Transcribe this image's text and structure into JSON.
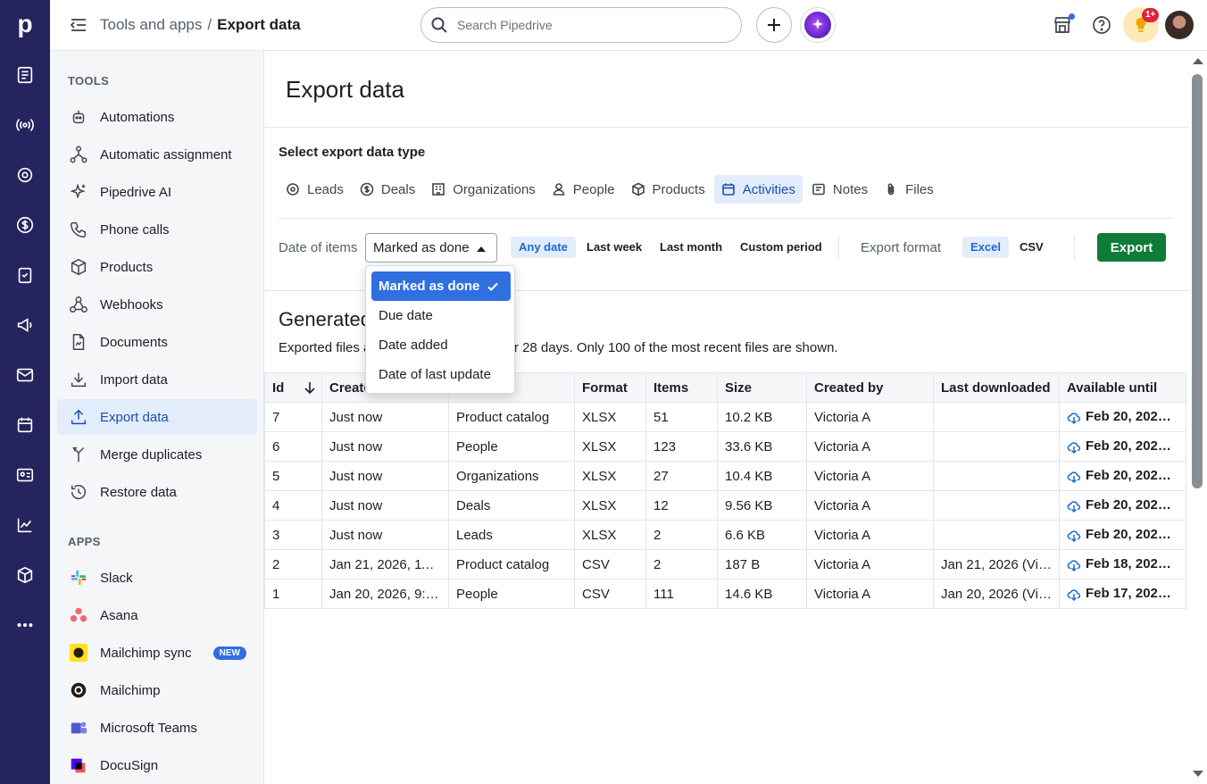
{
  "app": {
    "name": "Pipedrive"
  },
  "header": {
    "breadcrumb_parent": "Tools and apps",
    "breadcrumb_sep": "/",
    "breadcrumb_current": "Export data",
    "search_placeholder": "Search Pipedrive",
    "notification_badge": "1+"
  },
  "rail": {
    "icons": [
      "leads-inbox-icon",
      "broadcast-icon",
      "target-icon",
      "dollar-icon",
      "tasks-icon",
      "megaphone-icon",
      "mail-icon",
      "calendar-icon",
      "contacts-icon",
      "chart-icon",
      "products-box-icon",
      "more-icon"
    ]
  },
  "sidebar": {
    "tools_heading": "TOOLS",
    "tools": [
      {
        "label": "Automations",
        "icon": "robot-icon"
      },
      {
        "label": "Automatic assignment",
        "icon": "assignment-icon"
      },
      {
        "label": "Pipedrive AI",
        "icon": "sparkle-icon"
      },
      {
        "label": "Phone calls",
        "icon": "phone-icon"
      },
      {
        "label": "Products",
        "icon": "box-icon"
      },
      {
        "label": "Webhooks",
        "icon": "webhook-icon"
      },
      {
        "label": "Documents",
        "icon": "document-icon"
      },
      {
        "label": "Import data",
        "icon": "import-icon"
      },
      {
        "label": "Export data",
        "icon": "export-icon"
      },
      {
        "label": "Merge duplicates",
        "icon": "merge-icon"
      },
      {
        "label": "Restore data",
        "icon": "restore-icon"
      }
    ],
    "apps_heading": "APPS",
    "apps": [
      {
        "label": "Slack",
        "icon": "slack-icon"
      },
      {
        "label": "Asana",
        "icon": "asana-icon"
      },
      {
        "label": "Mailchimp sync",
        "icon": "mailchimp-icon",
        "badge": "NEW"
      },
      {
        "label": "Mailchimp",
        "icon": "mailchimp-icon"
      },
      {
        "label": "Microsoft Teams",
        "icon": "teams-icon"
      },
      {
        "label": "DocuSign",
        "icon": "docusign-icon"
      }
    ]
  },
  "main": {
    "title": "Export data",
    "select_type_label": "Select export data type",
    "tabs": [
      {
        "label": "Leads",
        "icon": "target-icon"
      },
      {
        "label": "Deals",
        "icon": "dollar-icon"
      },
      {
        "label": "Organizations",
        "icon": "building-icon"
      },
      {
        "label": "People",
        "icon": "person-icon"
      },
      {
        "label": "Products",
        "icon": "box-icon"
      },
      {
        "label": "Activities",
        "icon": "calendar-icon"
      },
      {
        "label": "Notes",
        "icon": "note-icon"
      },
      {
        "label": "Files",
        "icon": "paperclip-icon"
      }
    ],
    "active_tab": "Activities",
    "date_of_items_label": "Date of items",
    "date_of_items_value": "Marked as done",
    "date_filters": [
      "Any date",
      "Last week",
      "Last month",
      "Custom period"
    ],
    "active_date_filter": "Any date",
    "export_format_label": "Export format",
    "formats": [
      "Excel",
      "CSV"
    ],
    "active_format": "Excel",
    "export_button": "Export",
    "generated_title": "Generated",
    "generated_sub_before": "Exported files a",
    "generated_sub_after": "for 28 days. Only 100 of the most recent files are shown."
  },
  "dropdown": {
    "options": [
      "Marked as done",
      "Due date",
      "Date added",
      "Date of last update"
    ],
    "selected": "Marked as done"
  },
  "table": {
    "headers": [
      "Id",
      "Create",
      "",
      "Format",
      "Items",
      "Size",
      "Created by",
      "Last downloaded",
      "Available until"
    ],
    "rows": [
      [
        "7",
        "Just now",
        "Product catalog",
        "XLSX",
        "51",
        "10.2 KB",
        "Victoria A",
        "",
        "Feb 20, 202…"
      ],
      [
        "6",
        "Just now",
        "People",
        "XLSX",
        "123",
        "33.6 KB",
        "Victoria A",
        "",
        "Feb 20, 202…"
      ],
      [
        "5",
        "Just now",
        "Organizations",
        "XLSX",
        "27",
        "10.4 KB",
        "Victoria A",
        "",
        "Feb 20, 202…"
      ],
      [
        "4",
        "Just now",
        "Deals",
        "XLSX",
        "12",
        "9.56 KB",
        "Victoria A",
        "",
        "Feb 20, 202…"
      ],
      [
        "3",
        "Just now",
        "Leads",
        "XLSX",
        "2",
        "6.6 KB",
        "Victoria A",
        "",
        "Feb 20, 202…"
      ],
      [
        "2",
        "Jan 21, 2026, 11:…",
        "Product catalog",
        "CSV",
        "2",
        "187 B",
        "Victoria A",
        "Jan 21, 2026 (Vi…",
        "Feb 18, 202…"
      ],
      [
        "1",
        "Jan 20, 2026, 9:…",
        "People",
        "CSV",
        "111",
        "14.6 KB",
        "Victoria A",
        "Jan 20, 2026 (Vi…",
        "Feb 17, 202…"
      ]
    ]
  },
  "colors": {
    "rail_bg": "#26245e",
    "accent": "#2f6fe0",
    "export_green": "#0e7c37",
    "active_bg": "#e2ecfb"
  }
}
